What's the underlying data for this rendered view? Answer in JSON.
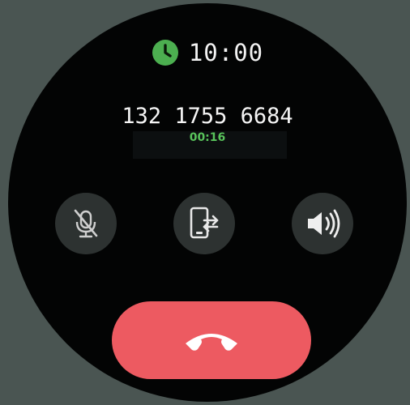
{
  "status": {
    "time": "10:00",
    "icon": "clock-icon",
    "icon_color": "#4caf50"
  },
  "call": {
    "number": "132 1755 6684",
    "duration": "00:16",
    "duration_color": "#58c35b"
  },
  "controls": [
    {
      "id": "mute",
      "icon": "microphone-muted-icon"
    },
    {
      "id": "transfer",
      "icon": "phone-transfer-icon"
    },
    {
      "id": "speaker",
      "icon": "speaker-icon"
    }
  ],
  "end_call": {
    "icon": "hang-up-icon",
    "color": "#ed5a61"
  }
}
